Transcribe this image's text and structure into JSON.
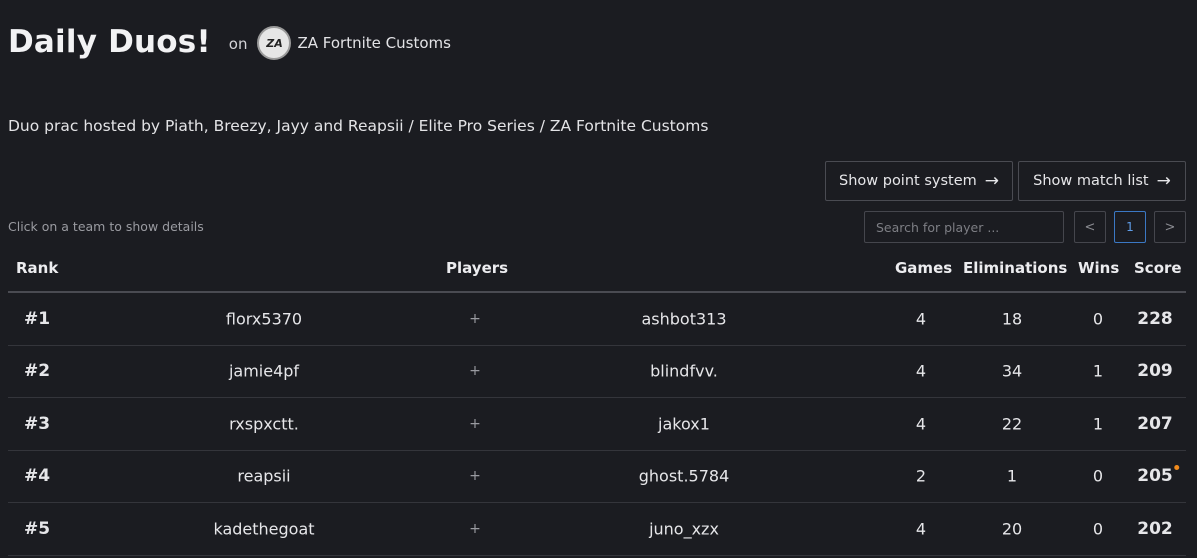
{
  "header": {
    "title": "Daily Duos!",
    "on": "on",
    "org_logo_text": "ZA",
    "org_name": "ZA Fortnite Customs"
  },
  "description": "Duo prac hosted by Piath, Breezy, Jayy and Reapsii / Elite Pro Series / ZA Fortnite Customs",
  "buttons": {
    "points": "Show point system",
    "matches": "Show match list",
    "arrow_icon": "arrow-right-icon"
  },
  "hint": "Click on a team to show details",
  "search": {
    "placeholder": "Search for player ...",
    "value": ""
  },
  "pagination": {
    "prev": "<",
    "current": "1",
    "next": ">"
  },
  "table": {
    "headers": {
      "rank": "Rank",
      "players": "Players",
      "games": "Games",
      "eliminations": "Eliminations",
      "wins": "Wins",
      "score": "Score"
    },
    "rows": [
      {
        "rank": "#1",
        "player1": "florx5370",
        "sep": "+",
        "player2": "ashbot313",
        "games": "4",
        "eliminations": "18",
        "wins": "0",
        "score": "228"
      },
      {
        "rank": "#2",
        "player1": "jamie4pf",
        "sep": "+",
        "player2": "blindfvv.",
        "games": "4",
        "eliminations": "34",
        "wins": "1",
        "score": "209"
      },
      {
        "rank": "#3",
        "player1": "rxspxctt.",
        "sep": "+",
        "player2": "jakox1",
        "games": "4",
        "eliminations": "22",
        "wins": "1",
        "score": "207"
      },
      {
        "rank": "#4",
        "player1": "reapsii",
        "sep": "+",
        "player2": "ghost.5784",
        "games": "2",
        "eliminations": "1",
        "wins": "0",
        "score": "205",
        "indicator_color": "#f08a1c"
      },
      {
        "rank": "#5",
        "player1": "kadethegoat",
        "sep": "+",
        "player2": "juno_xzx",
        "games": "4",
        "eliminations": "20",
        "wins": "0",
        "score": "202"
      }
    ]
  }
}
